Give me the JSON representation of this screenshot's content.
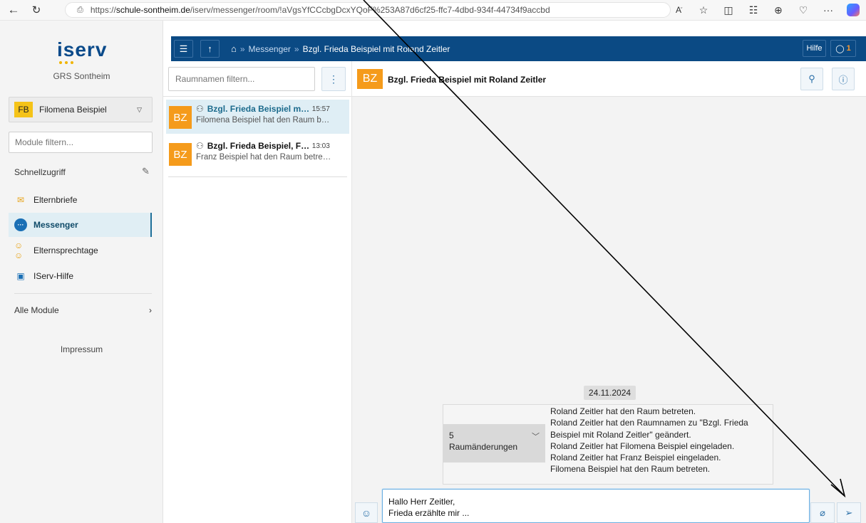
{
  "browser": {
    "url_prefix": "https://",
    "url_host": "schule-sontheim.de",
    "url_path": "/iserv/messenger/room/!aVgsYfCCcbgDcxYQoF%253A87d6cf25-ffc7-4dbd-934f-44734f9accbd"
  },
  "sidebar": {
    "logo": "IServ",
    "school": "GRS Sontheim",
    "user_initials": "FB",
    "user_name": "Filomena Beispiel",
    "module_filter_placeholder": "Module filtern...",
    "quick_access_label": "Schnellzugriff",
    "items": [
      {
        "label": "Elternbriefe"
      },
      {
        "label": "Messenger"
      },
      {
        "label": "Elternsprechtage"
      },
      {
        "label": "IServ-Hilfe"
      }
    ],
    "all_modules_label": "Alle Module",
    "impressum_label": "Impressum"
  },
  "appbar": {
    "breadcrumb_messenger": "Messenger",
    "breadcrumb_room": "Bzgl. Frieda Beispiel mit Roland Zeitler",
    "help_label": "Hilfe",
    "chat_count": "1"
  },
  "rooms": {
    "filter_placeholder": "Raumnamen filtern...",
    "items": [
      {
        "initials": "BZ",
        "name": "Bzgl. Frieda Beispiel mi…",
        "time": "15:57",
        "last": "Filomena Beispiel hat den Raum b…"
      },
      {
        "initials": "BZ",
        "name": "Bzgl. Frieda Beispiel, F…",
        "time": "13:03",
        "last": "Franz Beispiel hat den Raum betre…"
      }
    ]
  },
  "chat": {
    "initials": "BZ",
    "title": "Bzgl. Frieda Beispiel mit Roland Zeitler",
    "date": "24.11.2024",
    "events_count": "5",
    "events_label": "Raumänderungen",
    "events": [
      "Roland Zeitler hat den Raum betreten.",
      "Roland Zeitler hat den Raumnamen zu \"Bzgl. Frieda Beispiel mit Roland Zeitler\" geändert.",
      "Roland Zeitler hat Filomena Beispiel eingeladen.",
      "Roland Zeitler hat Franz Beispiel eingeladen.",
      "Filomena Beispiel hat den Raum betreten."
    ],
    "draft_line1": "Hallo Herr Zeitler,",
    "draft_line2": "Frieda erzählte mir ..."
  }
}
